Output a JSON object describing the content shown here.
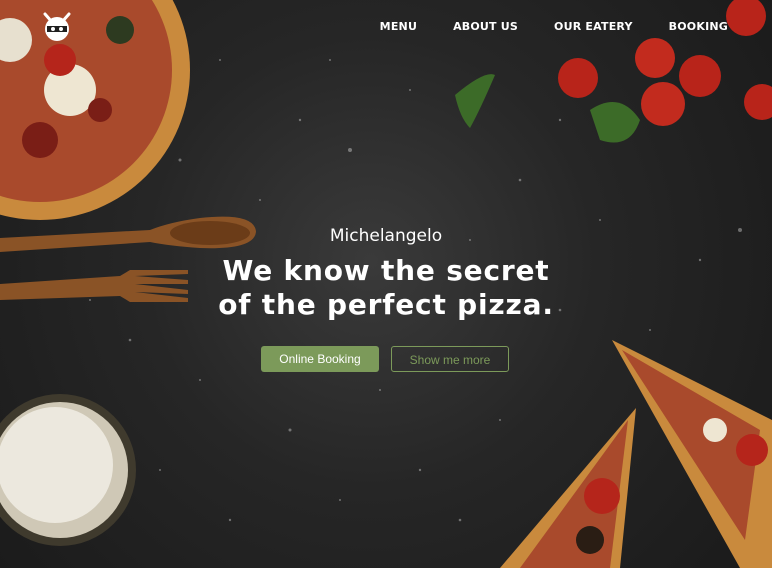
{
  "nav": {
    "items": [
      "MENU",
      "ABOUT US",
      "OUR EATERY",
      "BOOKING"
    ]
  },
  "hero": {
    "brand": "Michelangelo",
    "headline_line1": "We know the secret",
    "headline_line2": "of the perfect pizza.",
    "primary_button": "Online Booking",
    "secondary_button": "Show me more"
  },
  "colors": {
    "accent": "#7c9a5a",
    "background": "#262626",
    "text": "#ffffff"
  },
  "icons": {
    "logo": "ninja-mascot-icon"
  }
}
